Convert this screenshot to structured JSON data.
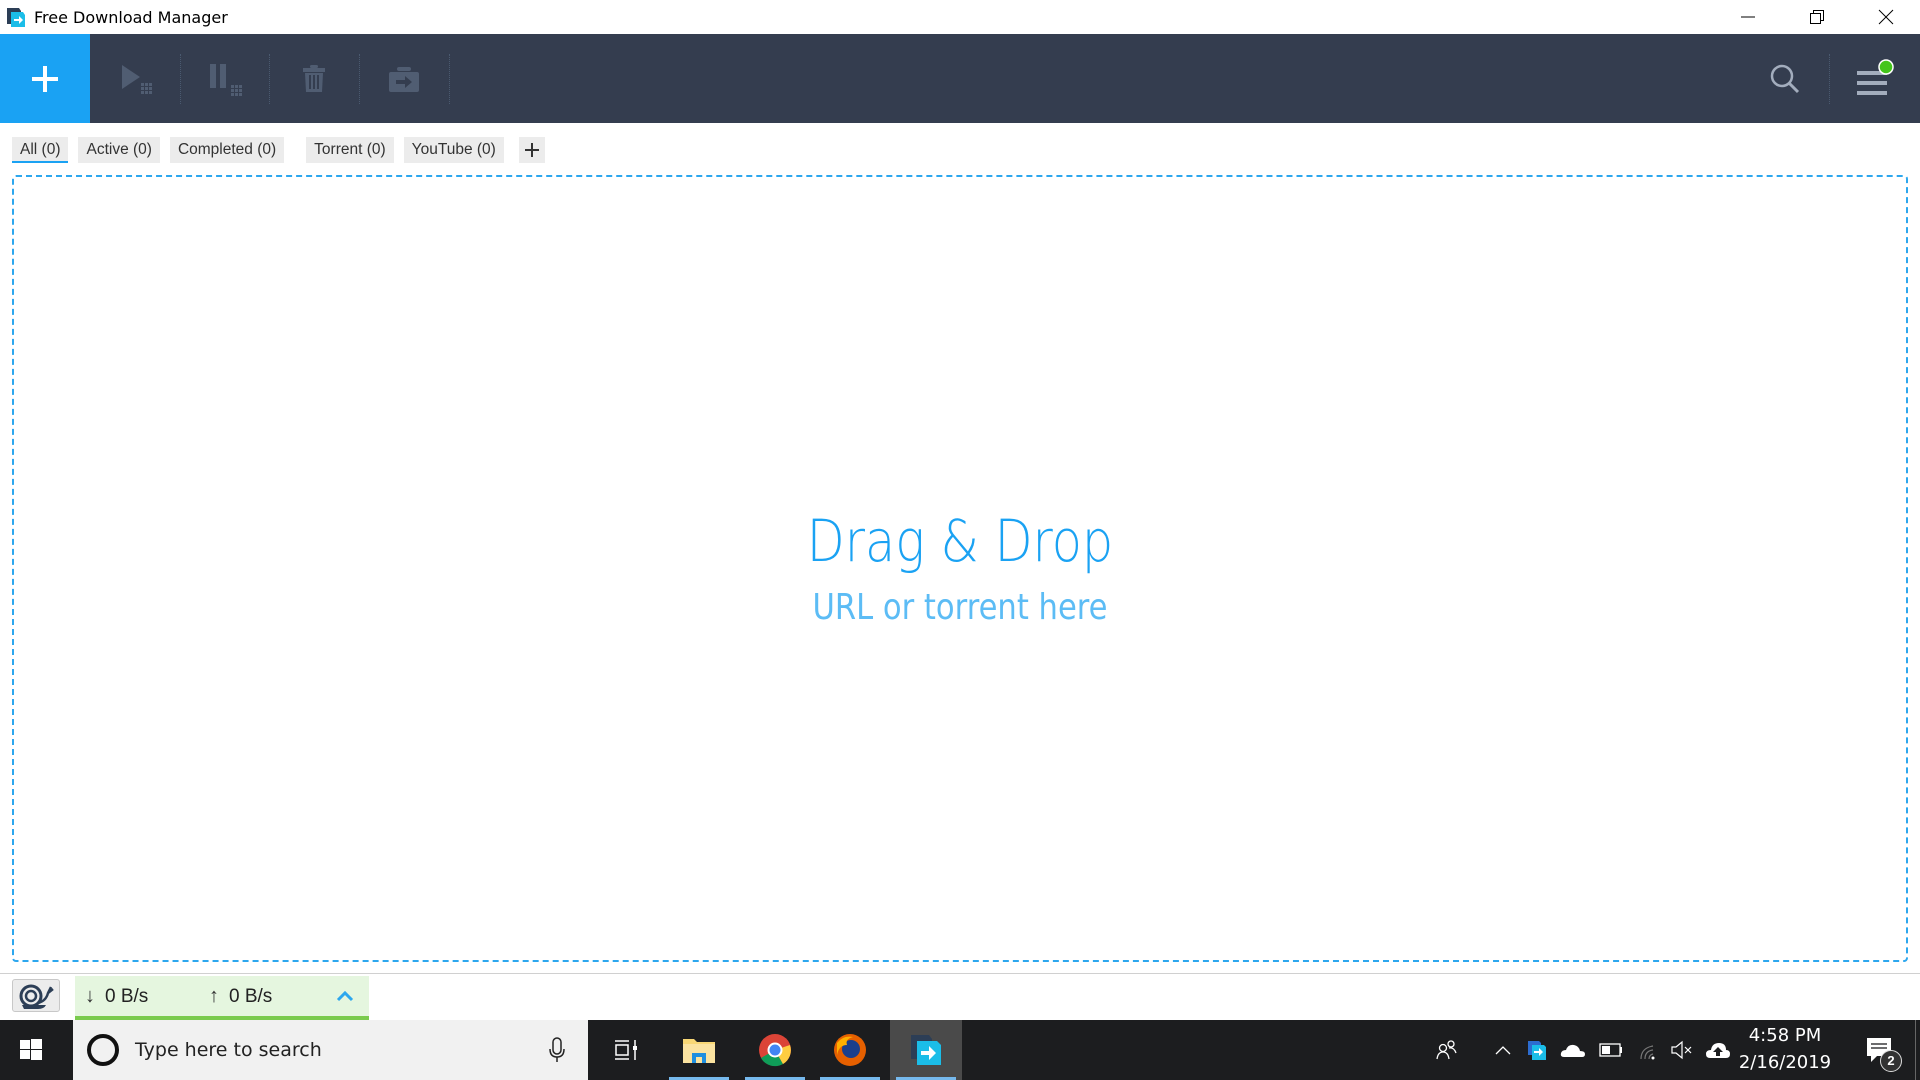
{
  "window": {
    "title": "Free Download Manager",
    "controls": [
      "minimize",
      "restore",
      "close"
    ]
  },
  "toolbar": {
    "add_icon": "plus-icon",
    "buttons": [
      {
        "name": "start",
        "icon": "play-icon",
        "enabled": false
      },
      {
        "name": "pause",
        "icon": "pause-icon",
        "enabled": false
      },
      {
        "name": "delete",
        "icon": "trash-icon",
        "enabled": false
      },
      {
        "name": "move",
        "icon": "folder-move-icon",
        "enabled": false
      }
    ],
    "search_icon": "search-icon",
    "menu_icon": "hamburger-menu-icon",
    "menu_notification_color": "#44c51b",
    "accent_color": "#1aa2f3",
    "background_color": "#343d4f"
  },
  "tabs": [
    {
      "label": "All (0)",
      "active": true
    },
    {
      "label": "Active (0)",
      "active": false
    },
    {
      "label": "Completed (0)",
      "active": false
    },
    {
      "label": "Torrent (0)",
      "active": false
    },
    {
      "label": "YouTube (0)",
      "active": false
    }
  ],
  "tab_add_label": "+",
  "dropzone": {
    "title": "Drag & Drop",
    "subtitle": "URL or torrent here"
  },
  "statusbar": {
    "snail_icon": "snail-icon",
    "download_arrow": "↓",
    "download_speed": "0 B/s",
    "upload_arrow": "↑",
    "upload_speed": "0 B/s",
    "expand_icon": "chevron-up-icon"
  },
  "taskbar": {
    "search_placeholder": "Type here to search",
    "apps": [
      {
        "name": "task-view",
        "running": false
      },
      {
        "name": "file-explorer",
        "running": true
      },
      {
        "name": "chrome",
        "running": true
      },
      {
        "name": "firefox",
        "running": true
      },
      {
        "name": "free-download-manager",
        "running": true,
        "focused": true
      }
    ],
    "tray": [
      "people",
      "show-hidden",
      "fdm",
      "onedrive",
      "battery",
      "wifi",
      "volume-muted",
      "upload"
    ],
    "time": "4:58 PM",
    "date": "2/16/2019",
    "notifications_count": "2"
  }
}
